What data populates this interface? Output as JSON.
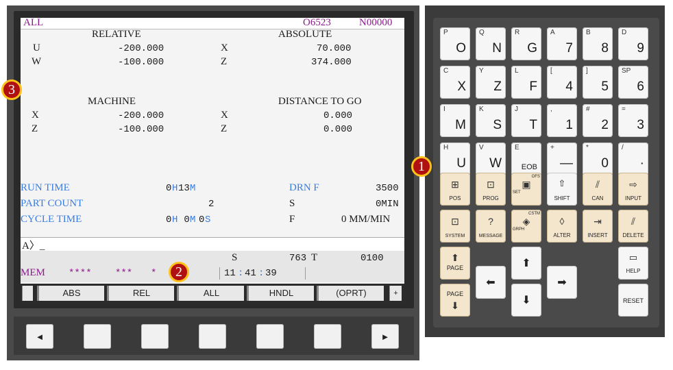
{
  "screen": {
    "top_left": "ALL",
    "program": "O6523",
    "sequence": "N00000",
    "relative": {
      "title": "RELATIVE",
      "rows": [
        {
          "axis": "U",
          "value": "-200.000"
        },
        {
          "axis": "W",
          "value": "-100.000"
        }
      ]
    },
    "absolute": {
      "title": "ABSOLUTE",
      "rows": [
        {
          "axis": "X",
          "value": "70.000"
        },
        {
          "axis": "Z",
          "value": "374.000"
        }
      ]
    },
    "machine": {
      "title": "MACHINE",
      "rows": [
        {
          "axis": "X",
          "value": "-200.000"
        },
        {
          "axis": "Z",
          "value": "-100.000"
        }
      ]
    },
    "distance": {
      "title": "DISTANCE TO GO",
      "rows": [
        {
          "axis": "X",
          "value": "0.000"
        },
        {
          "axis": "Z",
          "value": "0.000"
        }
      ]
    },
    "run_time": {
      "label": "RUN TIME",
      "h": "0",
      "hu": "H",
      "m": "13",
      "mu": "M"
    },
    "part_count": {
      "label": "PART COUNT",
      "value": "2"
    },
    "cycle_time": {
      "label": "CYCLE TIME",
      "h": "0",
      "hu": "H",
      "m": " 0",
      "mu": "M",
      "s": "0",
      "su": "S"
    },
    "drn": {
      "label": "DRN F",
      "value": "3500"
    },
    "s_label": "S",
    "s_value": "0MIN",
    "f_label": "F",
    "f_value": "0 MM/MIN",
    "input_prompt": "A〉_",
    "spindle": {
      "label": "S",
      "value": "763",
      "t_label": "T",
      "t_value": "0100"
    },
    "mode": "MEM",
    "stars1": "****",
    "stars2": "***",
    "stars3": "*",
    "time": {
      "h": "11",
      "m": "41",
      "s": "39"
    },
    "softkeys": [
      "ABS",
      "REL",
      "ALL",
      "HNDL",
      "(OPRT)"
    ],
    "softkey_more": "+"
  },
  "hardware_buttons": {
    "left": "◄",
    "right": "►"
  },
  "callouts": [
    "1",
    "2",
    "3"
  ],
  "keypad": {
    "row1": [
      {
        "sup": "P",
        "main": "O"
      },
      {
        "sup": "Q",
        "main": "N"
      },
      {
        "sup": "R",
        "main": "G"
      },
      {
        "sup": "A",
        "main": "7"
      },
      {
        "sup": "B",
        "main": "8"
      },
      {
        "sup": "D",
        "main": "9"
      }
    ],
    "row2": [
      {
        "sup": "C",
        "main": "X"
      },
      {
        "sup": "Y",
        "main": "Z"
      },
      {
        "sup": "L",
        "main": "F"
      },
      {
        "sup": "[",
        "main": "4"
      },
      {
        "sup": "]",
        "main": "5"
      },
      {
        "sup": "SP",
        "main": "6"
      }
    ],
    "row3": [
      {
        "sup": "I",
        "main": "M"
      },
      {
        "sup": "K",
        "main": "S"
      },
      {
        "sup": "J",
        "main": "T"
      },
      {
        "sup": ",",
        "main": "1"
      },
      {
        "sup": "#",
        "main": "2"
      },
      {
        "sup": "=",
        "main": "3"
      }
    ],
    "row4": [
      {
        "sup": "H",
        "main": "U"
      },
      {
        "sup": "V",
        "main": "W"
      },
      {
        "sup": "E",
        "main": "EOB"
      },
      {
        "sup": "+",
        "main": "—"
      },
      {
        "sup": "*",
        "main": "0"
      },
      {
        "sup": "/",
        "main": "·"
      }
    ],
    "func1": [
      "POS",
      "PROG",
      "SET",
      "OFS",
      "SHIFT",
      "CAN",
      "INPUT"
    ],
    "func2": [
      "SYSTEM",
      "MESSAGE",
      "GRPH",
      "CSTM",
      "ALTER",
      "INSERT",
      "DELETE"
    ],
    "page_up": "PAGE",
    "page_down": "PAGE",
    "help": "HELP",
    "reset": "RESET"
  }
}
